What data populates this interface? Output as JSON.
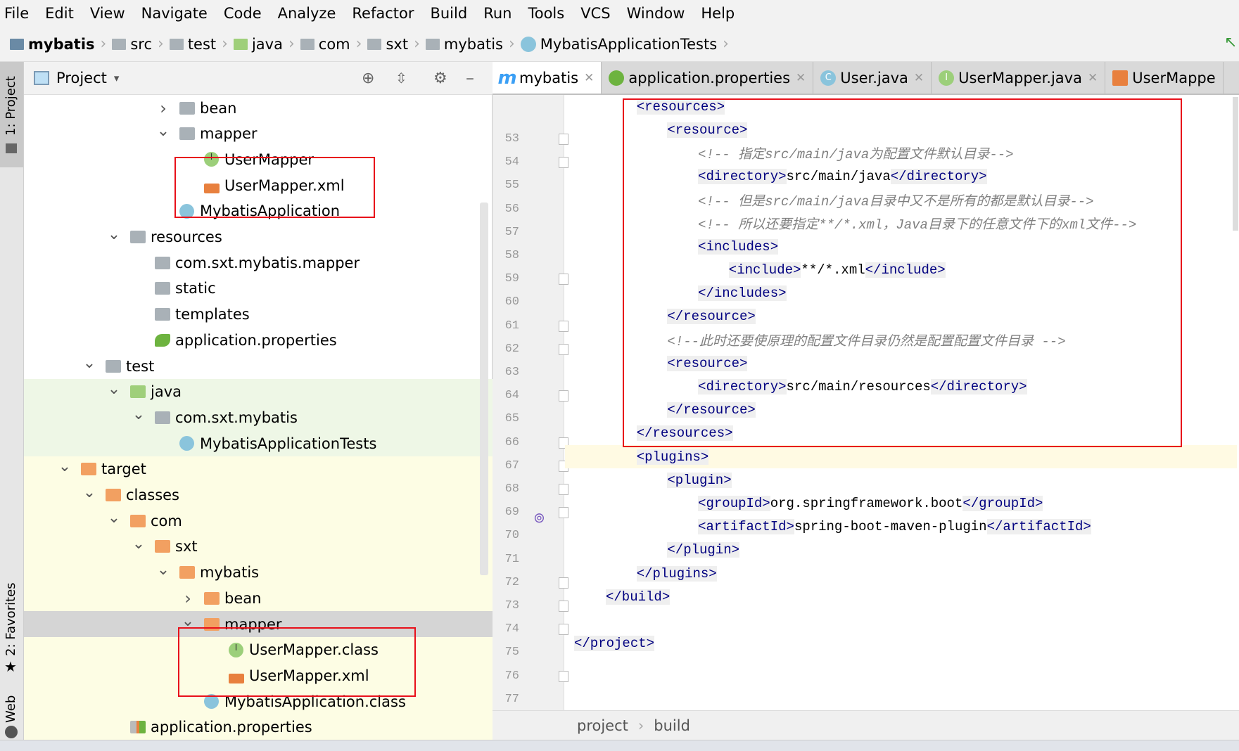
{
  "menu": [
    "File",
    "Edit",
    "View",
    "Navigate",
    "Code",
    "Analyze",
    "Refactor",
    "Build",
    "Run",
    "Tools",
    "VCS",
    "Window",
    "Help"
  ],
  "breadcrumb": [
    "mybatis",
    "src",
    "test",
    "java",
    "com",
    "sxt",
    "mybatis",
    "MybatisApplicationTests"
  ],
  "side_tools": {
    "project": "1: Project",
    "favorites": "2: Favorites",
    "web": "Web"
  },
  "project_panel": {
    "title": "Project",
    "view_selector": "▾"
  },
  "tree": [
    {
      "label": "bean",
      "level": 4,
      "expanded": false,
      "icon": "folder"
    },
    {
      "label": "mapper",
      "level": 4,
      "expanded": true,
      "icon": "folder"
    },
    {
      "label": "UserMapper",
      "level": 5,
      "icon": "interface"
    },
    {
      "label": "UserMapper.xml",
      "level": 5,
      "icon": "xml"
    },
    {
      "label": "MybatisApplication",
      "level": 4,
      "icon": "spring-class"
    },
    {
      "label": "resources",
      "level": 2,
      "expanded": true,
      "icon": "resources-folder"
    },
    {
      "label": "com.sxt.mybatis.mapper",
      "level": 3,
      "icon": "folder"
    },
    {
      "label": "static",
      "level": 3,
      "icon": "folder"
    },
    {
      "label": "templates",
      "level": 3,
      "icon": "folder"
    },
    {
      "label": "application.properties",
      "level": 3,
      "icon": "spring-properties"
    },
    {
      "label": "test",
      "level": 1,
      "expanded": true,
      "icon": "folder"
    },
    {
      "label": "java",
      "level": 2,
      "expanded": true,
      "icon": "test-folder"
    },
    {
      "label": "com.sxt.mybatis",
      "level": 3,
      "expanded": true,
      "icon": "folder"
    },
    {
      "label": "MybatisApplicationTests",
      "level": 4,
      "icon": "test-class"
    },
    {
      "label": "target",
      "level": 0,
      "expanded": true,
      "icon": "excluded-folder"
    },
    {
      "label": "classes",
      "level": 1,
      "expanded": true,
      "icon": "excluded-folder"
    },
    {
      "label": "com",
      "level": 2,
      "expanded": true,
      "icon": "excluded-folder"
    },
    {
      "label": "sxt",
      "level": 3,
      "expanded": true,
      "icon": "excluded-folder"
    },
    {
      "label": "mybatis",
      "level": 4,
      "expanded": true,
      "icon": "excluded-folder"
    },
    {
      "label": "bean",
      "level": 5,
      "expanded": false,
      "icon": "excluded-folder"
    },
    {
      "label": "mapper",
      "level": 5,
      "expanded": true,
      "icon": "excluded-folder",
      "selected": true
    },
    {
      "label": "UserMapper.class",
      "level": 6,
      "icon": "interface"
    },
    {
      "label": "UserMapper.xml",
      "level": 6,
      "icon": "xml"
    },
    {
      "label": "MybatisApplication.class",
      "level": 5,
      "icon": "class"
    },
    {
      "label": "application.properties",
      "level": 2,
      "icon": "properties"
    }
  ],
  "tabs": [
    {
      "label": "mybatis",
      "icon": "maven-m",
      "active": true
    },
    {
      "label": "application.properties",
      "icon": "spring-properties"
    },
    {
      "label": "User.java",
      "icon": "class"
    },
    {
      "label": "UserMapper.java",
      "icon": "interface"
    },
    {
      "label": "UserMappe",
      "icon": "xml"
    }
  ],
  "code_lines": [
    {
      "n": 53,
      "text": "  <resources>"
    },
    {
      "n": 54,
      "text": "    <resource>"
    },
    {
      "n": 55,
      "text": "      <!-- 指定src/main/java为配置文件默认目录-->"
    },
    {
      "n": 56,
      "text": "      <directory>src/main/java</directory>"
    },
    {
      "n": 57,
      "text": "      <!-- 但是src/main/java目录中又不是所有的都是默认目录-->"
    },
    {
      "n": 58,
      "text": "      <!-- 所以还要指定**/*.xml，Java目录下的任意文件下的xml文件-->"
    },
    {
      "n": 59,
      "text": "      <includes>"
    },
    {
      "n": 60,
      "text": "        <include>**/*.xml</include>"
    },
    {
      "n": 61,
      "text": "      </includes>"
    },
    {
      "n": 62,
      "text": "    </resource>"
    },
    {
      "n": 63,
      "text": "    <!--此时还要使原理的配置文件目录仍然是配置配置文件目录 -->"
    },
    {
      "n": 64,
      "text": "    <resource>"
    },
    {
      "n": 65,
      "text": "      <directory>src/main/resources</directory>"
    },
    {
      "n": 66,
      "text": "    </resource>"
    },
    {
      "n": 67,
      "text": "  </resources>"
    },
    {
      "n": 68,
      "text": "  <plugins>",
      "current": true
    },
    {
      "n": 69,
      "text": "    <plugin>"
    },
    {
      "n": 70,
      "text": "      <groupId>org.springframework.boot</groupId>"
    },
    {
      "n": 71,
      "text": "      <artifactId>spring-boot-maven-plugin</artifactId>"
    },
    {
      "n": 72,
      "text": "    </plugin>"
    },
    {
      "n": 73,
      "text": "  </plugins>"
    },
    {
      "n": 74,
      "text": "</build>"
    },
    {
      "n": 75,
      "text": ""
    },
    {
      "n": 76,
      "text": "</project>",
      "outdent": true
    },
    {
      "n": 77,
      "text": ""
    }
  ],
  "editor_breadcrumb": [
    "project",
    "build"
  ],
  "colors": {
    "highlight_box": "#e8101a",
    "tag": "#000080",
    "comment": "#808080",
    "excluded_bg": "#fdfde4",
    "test_bg": "#eef7e6"
  }
}
